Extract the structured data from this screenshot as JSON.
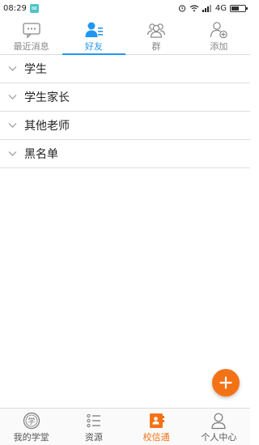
{
  "status_bar": {
    "time": "08:29",
    "network": "4G"
  },
  "top_tabs": [
    {
      "label": "最近消息",
      "icon": "chat-bubble-icon",
      "active": false
    },
    {
      "label": "好友",
      "icon": "friends-icon",
      "active": true
    },
    {
      "label": "群",
      "icon": "group-icon",
      "active": false
    },
    {
      "label": "添加",
      "icon": "add-contact-icon",
      "active": false
    }
  ],
  "groups": [
    {
      "label": "学生"
    },
    {
      "label": "学生家长"
    },
    {
      "label": "其他老师"
    },
    {
      "label": "黑名单"
    }
  ],
  "bottom_nav": [
    {
      "label": "我的学堂",
      "icon": "school-badge-icon",
      "active": false
    },
    {
      "label": "资源",
      "icon": "list-icon",
      "active": false
    },
    {
      "label": "校信通",
      "icon": "contacts-book-icon",
      "active": true
    },
    {
      "label": "个人中心",
      "icon": "person-icon",
      "active": false
    }
  ],
  "colors": {
    "accent_blue": "#2196f3",
    "accent_orange": "#f47216"
  }
}
